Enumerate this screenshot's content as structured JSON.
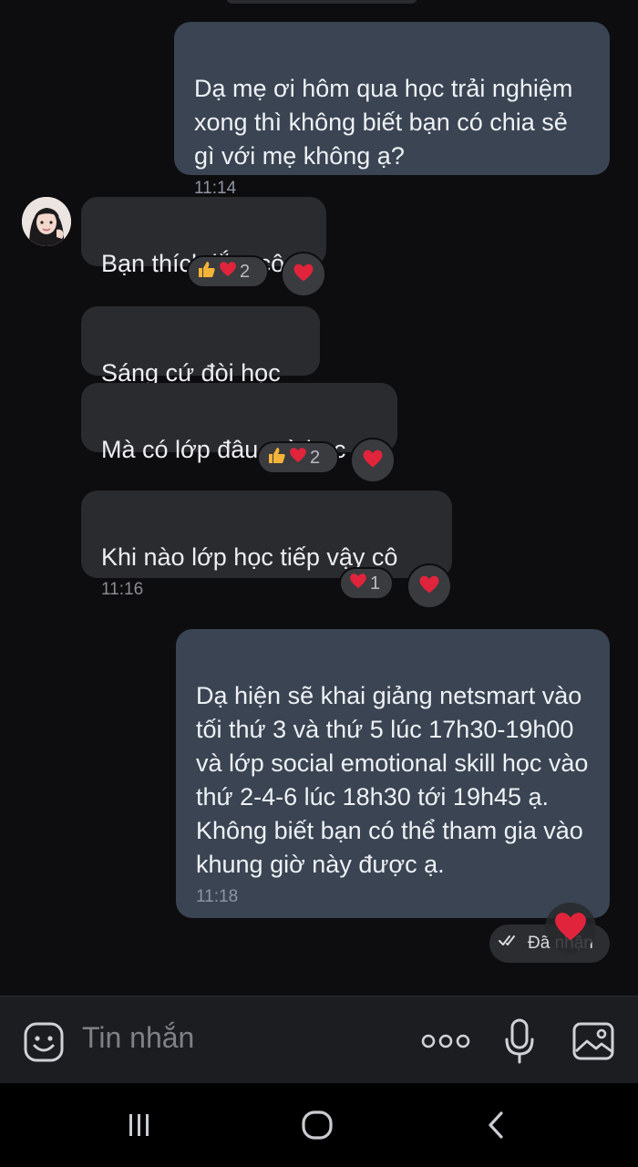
{
  "messages": {
    "m1": {
      "text": "Dạ mẹ ơi hôm qua học trải nghiệm xong thì không biết bạn có chia sẻ gì với mẹ không ạ?",
      "time": "11:14"
    },
    "m2": {
      "text": "Bạn thích lắm cô",
      "reactions_count": "2"
    },
    "m3": {
      "text": "Sáng cứ đòi học"
    },
    "m4": {
      "text": "Mà có lớp đâu mà học",
      "reactions_count": "2"
    },
    "m5": {
      "text": "Khi nào lớp học tiếp vậy cô",
      "time": "11:16",
      "reactions_count": "1"
    },
    "m6": {
      "text": "Dạ hiện sẽ khai giảng netsmart vào tối thứ 3 và thứ 5 lúc 17h30-19h00 và lớp social emotional skill học vào thứ 2-4-6 lúc 18h30 tới 19h45 ạ. Không biết bạn có thể tham gia vào khung giờ này được ạ.",
      "time": "11:18"
    }
  },
  "status": {
    "label": "Đã nhận"
  },
  "input": {
    "placeholder": "Tin nhắn"
  },
  "icons": {
    "emoji": "emoji-icon",
    "more": "more-icon",
    "mic": "mic-icon",
    "gallery": "gallery-icon",
    "heart": "heart-icon",
    "thumbs_up": "thumbs-up-icon",
    "double_check": "double-check-icon"
  },
  "colors": {
    "outgoing_bubble": "#3a4452",
    "incoming_bubble": "#2a2b2f",
    "heart": "#e0243b",
    "thumb": "#f5b437"
  }
}
